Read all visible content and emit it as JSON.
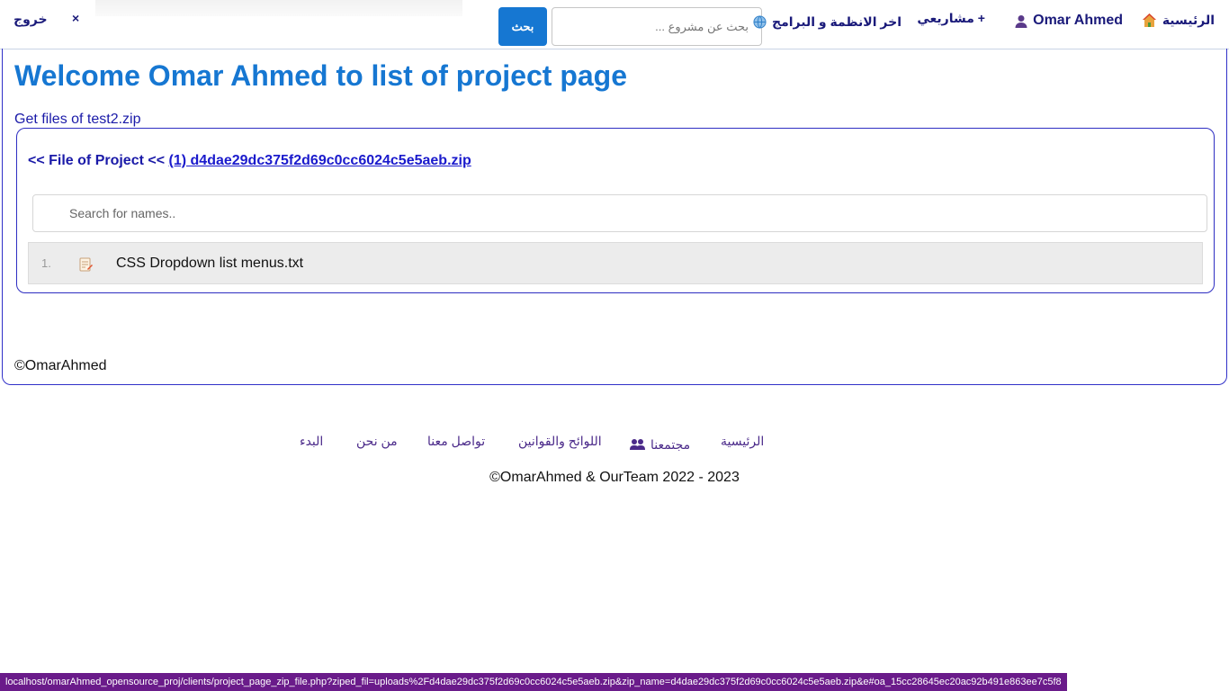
{
  "nav": {
    "home_label": "الرئيسية",
    "user_label": "Omar Ahmed",
    "projects_label": "مشاريعي +",
    "systems_label": "اخر الانظمة و البرامج",
    "close_label": "×",
    "logout_label": "خروج"
  },
  "search": {
    "placeholder": "بحث عن مشروع ...",
    "button_label": "بحث"
  },
  "main": {
    "title": "Welcome Omar Ahmed to list of project page",
    "get_files": "Get files of test2.zip",
    "file_header_prefix": "<< File of Project <<",
    "file_header_link": "(1) d4dae29dc375f2d69c0cc6024c5e5aeb.zip",
    "names_search_placeholder": "Search for names..",
    "files": [
      {
        "number": "1.",
        "name": "CSS Dropdown list menus.txt"
      }
    ],
    "copyright": "©OmarAhmed"
  },
  "footer": {
    "links": {
      "home": "الرئيسية",
      "community": "مجتمعنا",
      "rules": "اللوائح والقوانين",
      "contact": "تواصل معنا",
      "about": "من نحن",
      "start": "البدء"
    },
    "copyright": "©OmarAhmed & OurTeam 2022 - 2023"
  },
  "status_url": "localhost/omarAhmed_opensource_proj/clients/project_page_zip_file.php?ziped_fil=uploads%2Fd4dae29dc375f2d69c0cc6024c5e5aeb.zip&zip_name=d4dae29dc375f2d69c0cc6024c5e5aeb.zip&e#oa_15cc28645ec20ac92b491e863ee7c5f8",
  "colors": {
    "accent_blue": "#1677d2",
    "nav_text": "#1a1a7a",
    "border_blue": "#3030c8",
    "status_bar": "#6a1b8a"
  }
}
